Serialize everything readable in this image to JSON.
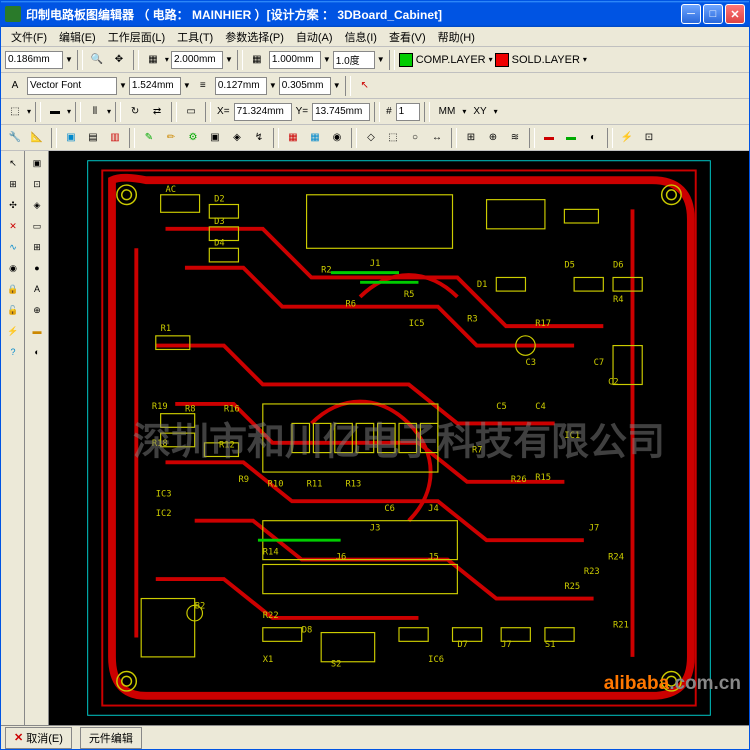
{
  "window": {
    "title": "印制电路板图编辑器 （ 电路： MAINHIER ）[设计方案 ： 3DBoard_Cabinet]"
  },
  "menu": {
    "file": "文件(F)",
    "edit": "编辑(E)",
    "layers": "工作层面(L)",
    "tools": "工具(T)",
    "params": "参数选择(P)",
    "auto": "自动(A)",
    "info": "信息(I)",
    "view": "查看(V)",
    "help": "帮助(H)"
  },
  "toolbar1": {
    "width": "0.186mm",
    "grid1": "2.000mm",
    "grid2": "1.000mm",
    "angle": "1.0度"
  },
  "toolbar2": {
    "font": "Vector Font",
    "size1": "1.524mm",
    "size2": "0.127mm",
    "size3": "0.305mm"
  },
  "layers": {
    "comp": "COMP.LAYER",
    "sold": "SOLD.LAYER"
  },
  "coords": {
    "x_label": "X=",
    "x": "71.324mm",
    "y_label": "Y=",
    "y": "13.745mm",
    "num_label": "#",
    "num": "1",
    "unit": "MM",
    "xy": "XY"
  },
  "colors": {
    "comp": "#00cc00",
    "sold": "#ee0000"
  },
  "status": {
    "cancel": "取消(E)",
    "edit": "元件编辑"
  },
  "watermark": "深圳市和川亿电子科技有限公司",
  "watermark2_main": "alibaba",
  "watermark2_suffix": ".com.cn",
  "pcb_labels": [
    "AC",
    "D2",
    "D3",
    "D4",
    "R2",
    "J1",
    "D1",
    "R5",
    "D5",
    "D6",
    "R4",
    "R6",
    "R1",
    "R3",
    "R17",
    "C3",
    "C7",
    "C2",
    "R19",
    "R8",
    "R16",
    "C5",
    "C4",
    "IC1",
    "R18",
    "R12",
    "R9",
    "IC3",
    "R10",
    "R11",
    "R13",
    "R15",
    "IC2",
    "R26",
    "C6",
    "J4",
    "J3",
    "R14",
    "J6",
    "J5",
    "J7",
    "R24",
    "R25",
    "R21",
    "R23",
    "R22",
    "B2",
    "X1",
    "D7",
    "IC6",
    "J7",
    "S1",
    "S2",
    "D8",
    "IC5",
    "R7"
  ]
}
